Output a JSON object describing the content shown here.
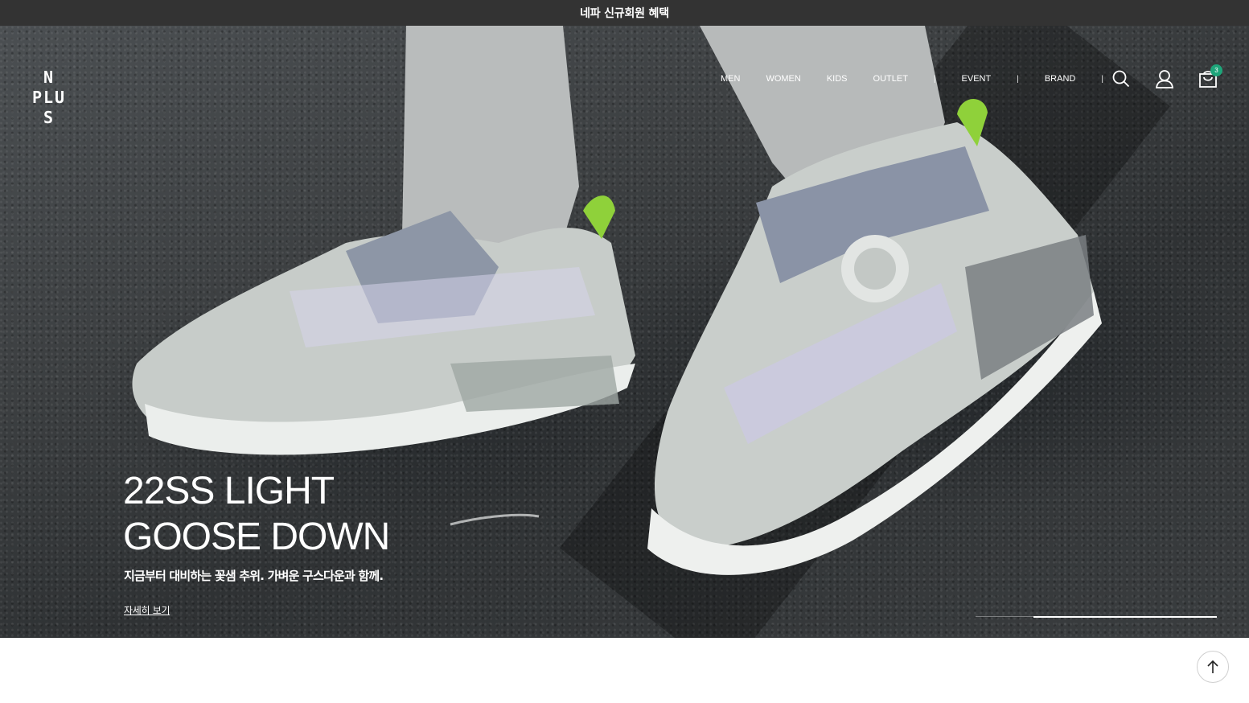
{
  "topbar": {
    "text": "네파 신규회원 혜택"
  },
  "logo": {
    "lines": [
      "N",
      "PLU",
      "S"
    ]
  },
  "nav": {
    "items": [
      "MEN",
      "WOMEN",
      "KIDS",
      "OUTLET",
      "EVENT",
      "BRAND"
    ],
    "separator": "|"
  },
  "header_icons": {
    "search": "search-icon",
    "account": "user-icon",
    "cart": "shopping-bag-icon",
    "cart_count": "3"
  },
  "hero": {
    "headline_line1": "22SS LIGHT",
    "headline_line2": "GOOSE DOWN",
    "subtitle": "지금부터 대비하는 꽃샘 추위. 가벼운 구스다운과 함께.",
    "more_link": "자세히 보기",
    "slide_progress": 0.76
  },
  "scroll_top": {
    "icon": "arrow-up-icon"
  },
  "colors": {
    "topbar_bg": "#333333",
    "badge": "#1ea57a",
    "accent_shoe": "#8fd13a"
  }
}
